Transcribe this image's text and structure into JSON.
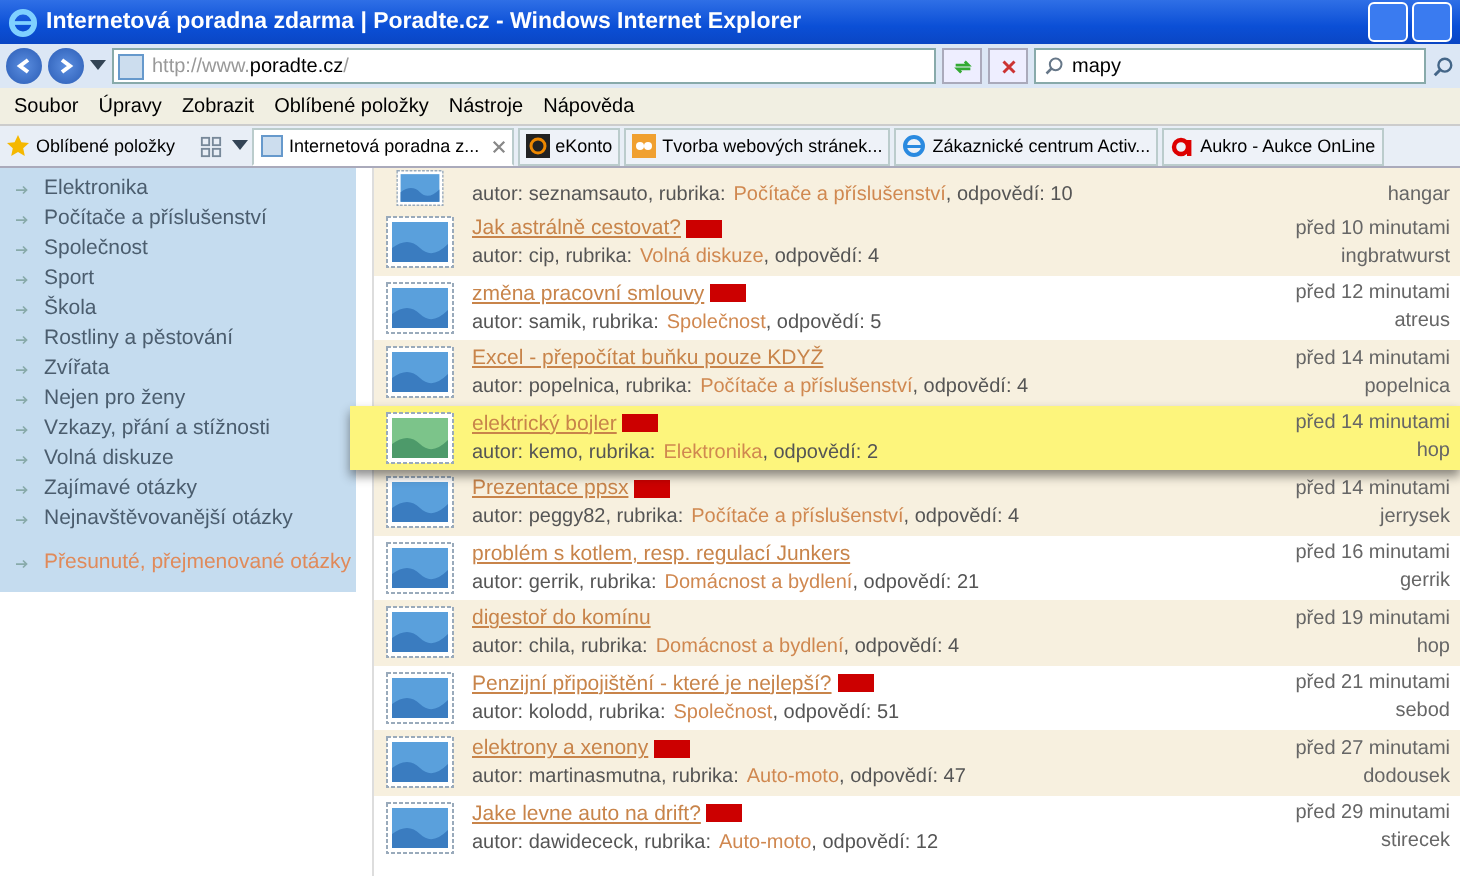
{
  "window": {
    "title": "Internetová poradna zdarma | Poradte.cz - Windows Internet Explorer"
  },
  "address": {
    "value_prefix": "http://www.",
    "value_domain": "poradte.cz",
    "value_suffix": "/"
  },
  "search": {
    "value": "mapy"
  },
  "menu": [
    "Soubor",
    "Úpravy",
    "Zobrazit",
    "Oblíbené položky",
    "Nástroje",
    "Nápověda"
  ],
  "favorites": {
    "label": "Oblíbené položky"
  },
  "tabs": [
    {
      "label": "Internetová poradna z...",
      "selected": true
    },
    {
      "label": "eKonto",
      "selected": false
    },
    {
      "label": "Tvorba webových stránek...",
      "selected": false
    },
    {
      "label": "Zákaznické centrum Activ...",
      "selected": false
    },
    {
      "label": "Aukro - Aukce OnLine",
      "selected": false
    }
  ],
  "sidebar": {
    "items": [
      {
        "label": "Elektronika",
        "special": false
      },
      {
        "label": "Počítače a příslušenství",
        "special": false
      },
      {
        "label": "Společnost",
        "special": false
      },
      {
        "label": "Sport",
        "special": false
      },
      {
        "label": "Škola",
        "special": false
      },
      {
        "label": "Rostliny a pěstování",
        "special": false
      },
      {
        "label": "Zvířata",
        "special": false
      },
      {
        "label": "Nejen pro ženy",
        "special": false
      },
      {
        "label": "Vzkazy, přání a stížnosti",
        "special": false
      },
      {
        "label": "Volná diskuze",
        "special": false
      },
      {
        "label": "Zajímavé otázky",
        "special": false
      },
      {
        "label": "Nejnavštěvovanější otázky",
        "special": false
      },
      {
        "label": "Přesunuté, přejmenované otázky",
        "special": true
      }
    ]
  },
  "questions": [
    {
      "author": "autor: seznamsauto, rubrika:",
      "category": "Počítače a příslušenství",
      "answers": ", odpovědí: 10",
      "user": "hangar",
      "shaded": true,
      "highlighted": false,
      "new": false
    },
    {
      "title": "Jak astrálně cestovat?",
      "author": "autor: cip, rubrika:",
      "category": "Volná diskuze",
      "answers": ", odpovědí: 4",
      "time": "před 10 minutami",
      "user": "ingbratwurst",
      "shaded": true,
      "highlighted": false,
      "new": true
    },
    {
      "title": "změna pracovní smlouvy",
      "author": "autor: samik, rubrika:",
      "category": "Společnost",
      "answers": ", odpovědí: 5",
      "time": "před 12 minutami",
      "user": "atreus",
      "shaded": false,
      "highlighted": false,
      "new": true
    },
    {
      "title": "Excel - přepočítat buňku pouze KDYŽ",
      "author": "autor: popelnica, rubrika:",
      "category": "Počítače a příslušenství",
      "answers": ", odpovědí: 4",
      "time": "před 14 minutami",
      "user": "popelnica",
      "shaded": true,
      "highlighted": false,
      "new": false
    },
    {
      "title": "elektrický bojler",
      "author": "autor: kemo, rubrika:",
      "category": "Elektronika",
      "answers": ", odpovědí: 2",
      "time": "před 14 minutami",
      "user": "hop",
      "highlighted": true,
      "new": true
    },
    {
      "title": "Prezentace ppsx",
      "author": "autor: peggy82, rubrika:",
      "category": "Počítače a příslušenství",
      "answers": ", odpovědí: 4",
      "time": "před 14 minutami",
      "user": "jerrysek",
      "shaded": true,
      "highlighted": false,
      "new": true
    },
    {
      "title": "problém s kotlem, resp. regulací Junkers",
      "author": "autor: gerrik, rubrika:",
      "category": "Domácnost a bydlení",
      "answers": ", odpovědí: 21",
      "time": "před 16 minutami",
      "user": "gerrik",
      "shaded": false,
      "highlighted": false,
      "new": false
    },
    {
      "title": "digestoř do komínu",
      "author": "autor: chila, rubrika:",
      "category": "Domácnost a bydlení",
      "answers": ", odpovědí: 4",
      "time": "před 19 minutami",
      "user": "hop",
      "shaded": true,
      "highlighted": false,
      "new": false
    },
    {
      "title": "Penzijní připojištění - které je nejlepší?",
      "author": "autor: kolodd, rubrika:",
      "category": "Společnost",
      "answers": ", odpovědí: 51",
      "time": "před 21 minutami",
      "user": "sebod",
      "shaded": false,
      "highlighted": false,
      "new": true
    },
    {
      "title": "elektrony a xenony",
      "author": "autor: martinasmutna, rubrika:",
      "category": "Auto-moto",
      "answers": ", odpovědí: 47",
      "time": "před 27 minutami",
      "user": "dodousek",
      "shaded": true,
      "highlighted": false,
      "new": true
    },
    {
      "title": "Jake levne auto na drift?",
      "author": "autor: dawidececk, rubrika:",
      "category": "Auto-moto",
      "answers": ", odpovědí: 12",
      "time": "před 29 minutami",
      "user": "stirecek",
      "shaded": false,
      "highlighted": false,
      "new": true
    }
  ]
}
